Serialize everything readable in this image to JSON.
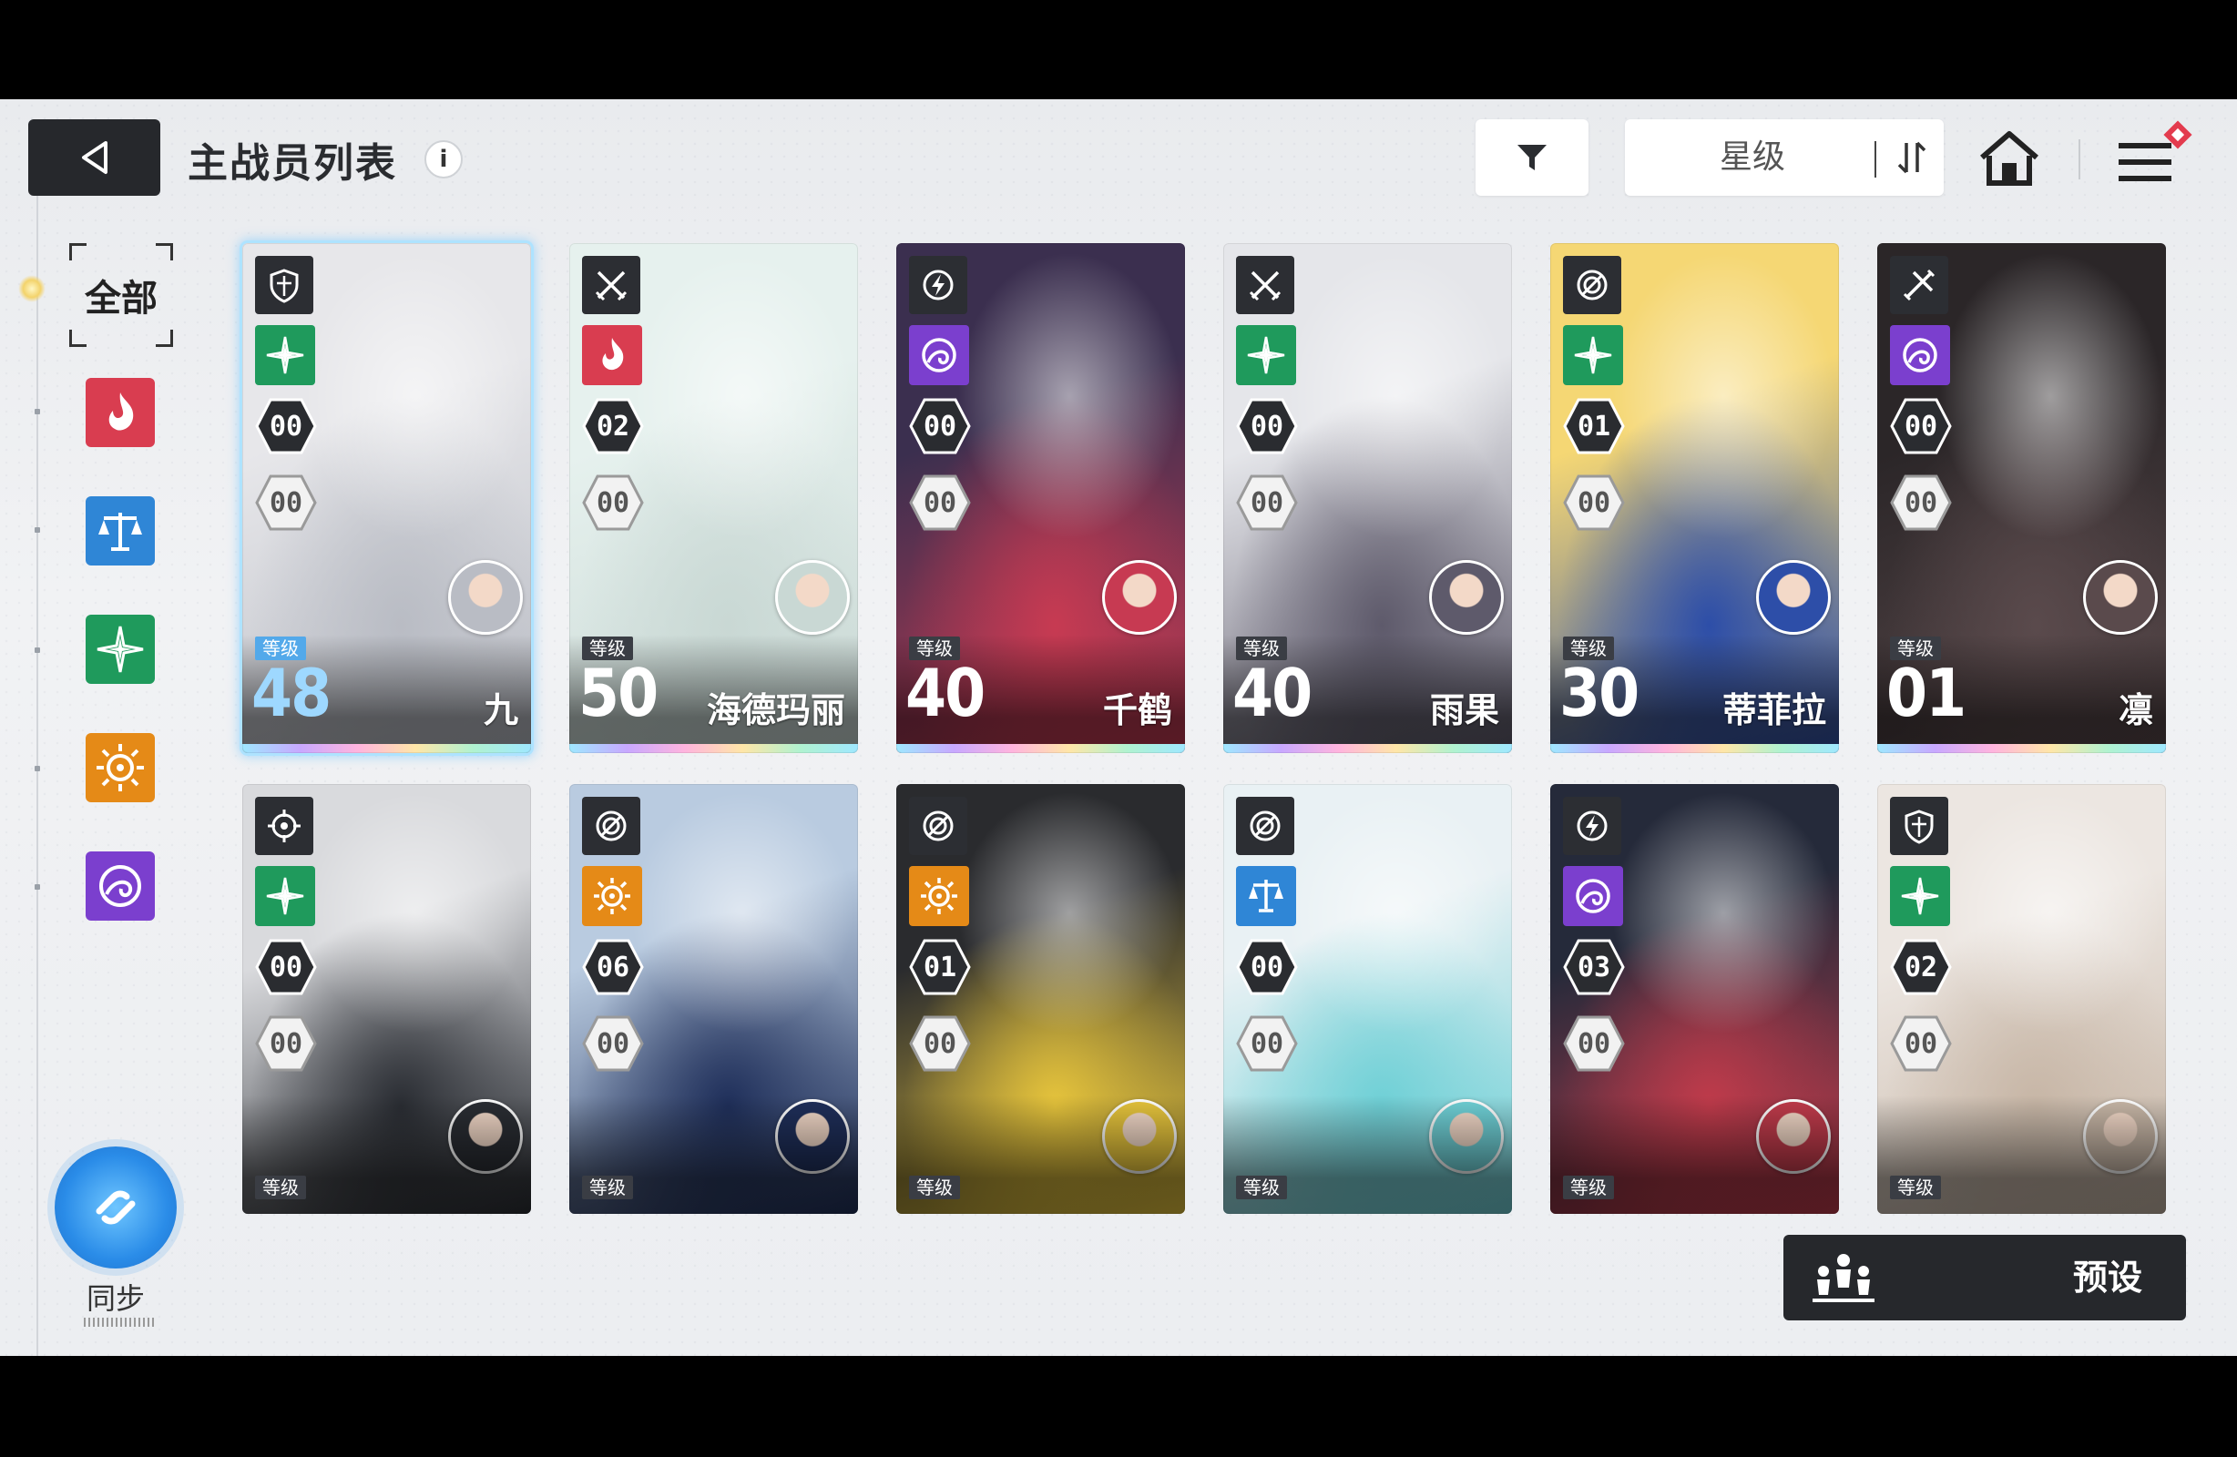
{
  "header": {
    "title": "主战员列表",
    "info_glyph": "i",
    "sort_label": "星级"
  },
  "categories": {
    "all_label": "全部",
    "items": [
      {
        "name": "fire",
        "color": "#d93d50"
      },
      {
        "name": "balance",
        "color": "#2f86d6"
      },
      {
        "name": "wind",
        "color": "#1f9a5c"
      },
      {
        "name": "sun",
        "color": "#e58a17"
      },
      {
        "name": "void",
        "color": "#7b3fce"
      }
    ]
  },
  "sync": {
    "label": "同步"
  },
  "preset": {
    "label": "预设"
  },
  "level_tag": "等级",
  "characters": [
    {
      "name": "九",
      "level": "48",
      "rank": "shield",
      "element": "wind",
      "stars": "00",
      "ascension": "00",
      "selected": true,
      "tint": [
        "#e7e7ea",
        "#b9bcc4"
      ]
    },
    {
      "name": "海德玛丽",
      "level": "50",
      "rank": "swords",
      "element": "fire",
      "stars": "02",
      "ascension": "00",
      "selected": false,
      "tint": [
        "#e6f1ee",
        "#c9d8d4"
      ]
    },
    {
      "name": "千鹤",
      "level": "40",
      "rank": "bolt",
      "element": "void",
      "stars": "00",
      "ascension": "00",
      "selected": false,
      "tint": [
        "#3b2f4f",
        "#c73a52"
      ]
    },
    {
      "name": "雨果",
      "level": "40",
      "rank": "swords",
      "element": "wind",
      "stars": "00",
      "ascension": "00",
      "selected": false,
      "tint": [
        "#e5e6ea",
        "#5e5a6b"
      ]
    },
    {
      "name": "蒂菲拉",
      "level": "30",
      "rank": "target",
      "element": "wind",
      "stars": "01",
      "ascension": "00",
      "selected": false,
      "tint": [
        "#f5d774",
        "#2d4ea8"
      ]
    },
    {
      "name": "凛",
      "level": "01",
      "rank": "crossed",
      "element": "void",
      "stars": "00",
      "ascension": "00",
      "selected": false,
      "tint": [
        "#2b2628",
        "#5a4a4c"
      ]
    },
    {
      "name": "",
      "level": "",
      "rank": "crosshair",
      "element": "wind",
      "stars": "00",
      "ascension": "00",
      "selected": false,
      "tint": [
        "#d9dadd",
        "#2a2d33"
      ]
    },
    {
      "name": "",
      "level": "",
      "rank": "target",
      "element": "sun",
      "stars": "06",
      "ascension": "00",
      "selected": false,
      "tint": [
        "#b9cbe0",
        "#1f2f5a"
      ]
    },
    {
      "name": "",
      "level": "",
      "rank": "target",
      "element": "sun",
      "stars": "01",
      "ascension": "00",
      "selected": false,
      "tint": [
        "#2a2b2e",
        "#e6c43c"
      ]
    },
    {
      "name": "",
      "level": "",
      "rank": "target",
      "element": "balance",
      "stars": "00",
      "ascension": "00",
      "selected": false,
      "tint": [
        "#e9f1f4",
        "#6fd0d6"
      ]
    },
    {
      "name": "",
      "level": "",
      "rank": "bolt",
      "element": "void",
      "stars": "03",
      "ascension": "00",
      "selected": false,
      "tint": [
        "#252a3a",
        "#c03b4b"
      ]
    },
    {
      "name": "",
      "level": "",
      "rank": "shield",
      "element": "wind",
      "stars": "02",
      "ascension": "00",
      "selected": false,
      "tint": [
        "#ece6e1",
        "#c7b6a6"
      ]
    }
  ]
}
